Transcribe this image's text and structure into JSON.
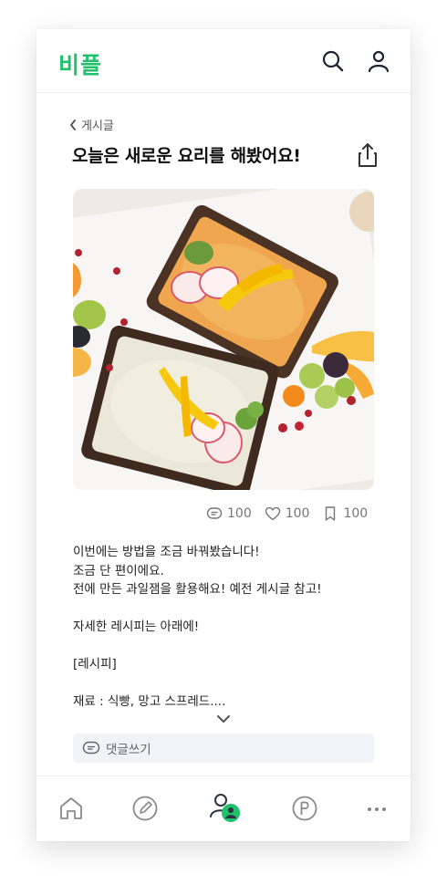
{
  "header": {
    "brand": "비플",
    "icons": [
      "search-icon",
      "user-icon"
    ]
  },
  "breadcrumb": {
    "label": "게시글"
  },
  "post": {
    "title": "오늘은 새로운 요리를 해봤어요!",
    "stats": {
      "comments": "100",
      "likes": "100",
      "bookmarks": "100"
    },
    "body_lines": [
      "이번에는 방법을 조금 바꿔봤습니다!",
      "조금 단 편이에요.",
      "전에 만든 과일잼을 활용해요! 예전 게시글 참고!",
      "",
      "자세한 레시피는 아래에!",
      "",
      "[레시피]",
      "",
      "재료 : 식빵, 망고 스프레드...."
    ]
  },
  "comment_bar": {
    "placeholder": "댓글쓰기"
  },
  "tabbar": {
    "items": [
      "home-icon",
      "write-icon",
      "community-icon",
      "point-icon",
      "more-icon"
    ],
    "active": "community-icon",
    "accent": "#21c16b"
  },
  "colors": {
    "brand": "#21c16b",
    "text": "#111111",
    "muted": "#777777"
  }
}
